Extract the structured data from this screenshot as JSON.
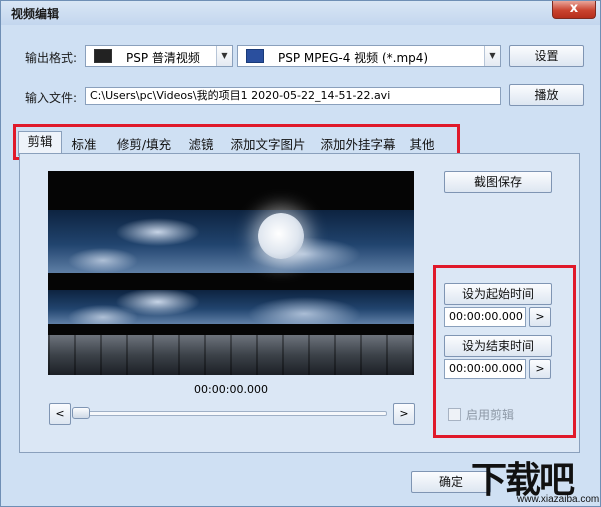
{
  "window": {
    "title": "视频编辑",
    "close_glyph": "x"
  },
  "output_format": {
    "label": "输出格式:",
    "device_value": "PSP 普清视频",
    "device_icon": "video-film-icon",
    "format_value": "PSP MPEG-4 视频 (*.mp4)",
    "format_icon": "mp4-file-icon",
    "settings_button": "设置"
  },
  "input_file": {
    "label": "输入文件:",
    "path": "C:\\Users\\pc\\Videos\\我的项目1 2020-05-22_14-51-22.avi",
    "play_button": "播放"
  },
  "tabs": [
    {
      "label": "剪辑",
      "active": true
    },
    {
      "label": "标准"
    },
    {
      "label": "修剪/填充"
    },
    {
      "label": "滤镜"
    },
    {
      "label": "添加文字图片"
    },
    {
      "label": "添加外挂字幕"
    },
    {
      "label": "其他"
    }
  ],
  "editor": {
    "snapshot_button": "截图保存",
    "current_time": "00:00:00.000",
    "slider_left": "<",
    "slider_right": ">",
    "set_start_button": "设为起始时间",
    "start_time": "00:00:00.000",
    "set_end_button": "设为结束时间",
    "end_time": "00:00:00.000",
    "go_button": ">",
    "enable_clip_label": "启用剪辑",
    "enable_clip_checked": false
  },
  "footer": {
    "ok_button": "确定"
  },
  "watermark": {
    "text": "下载吧",
    "site": "www.xiazaiba.com"
  },
  "colors": {
    "highlight": "#e0192a",
    "window_bg": "#cfe0f3"
  }
}
